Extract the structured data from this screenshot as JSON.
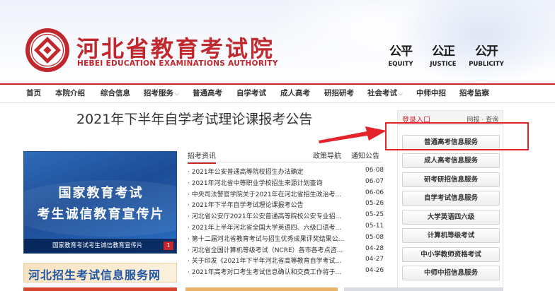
{
  "header": {
    "site_name_cn": "河北省教育考试院",
    "site_name_en": "HEBEI EDUCATION EXAMINATIONS AUTHORITY",
    "slogans": [
      {
        "zh": "公平",
        "en": "EQUITY"
      },
      {
        "zh": "公正",
        "en": "JUSTICE"
      },
      {
        "zh": "公开",
        "en": "PUBLICITY"
      }
    ],
    "brand_color": "#c0282d"
  },
  "nav": {
    "items": [
      {
        "label": "首页",
        "chevron": ""
      },
      {
        "label": "本院介绍",
        "chevron": ""
      },
      {
        "label": "综合信息",
        "chevron": ""
      },
      {
        "label": "招考服务",
        "chevron": "⌵"
      },
      {
        "label": "普通高考",
        "chevron": ""
      },
      {
        "label": "自学考试",
        "chevron": ""
      },
      {
        "label": "成人高考",
        "chevron": ""
      },
      {
        "label": "研招研考",
        "chevron": ""
      },
      {
        "label": "社会考试",
        "chevron": "⌵"
      },
      {
        "label": "中师中招",
        "chevron": ""
      },
      {
        "label": "招考监察",
        "chevron": ""
      }
    ]
  },
  "main": {
    "title": "2021年下半年自学考试理论课报考公告"
  },
  "banner": {
    "line1": "国家教育考试",
    "line2": "考生诚信教育宣传片",
    "caption": "国家教育考试考生诚信教育宣传片",
    "index": "1",
    "secondary": "河北招生考试信息服务网"
  },
  "news": {
    "tabs": [
      "招考资讯",
      "政策导航",
      "通知公告"
    ],
    "items": [
      {
        "title": "· 2021年公安普通高等院校招生办法确定",
        "date": "06-08"
      },
      {
        "title": "· 2021年河北省中等职业学校招生来源计划查询",
        "date": "06-07"
      },
      {
        "title": "· 中央司法警官学院关于2021年在河北省招生政治考...",
        "date": "06-06"
      },
      {
        "title": "· 2021年下半年自学考试理论课报考公告",
        "date": "05-26"
      },
      {
        "title": "· 河北省公安厅2021年公安普通高等院校公安专业招...",
        "date": "05-25"
      },
      {
        "title": "· 2021年上半年河北省全国大学英语四、六级口语考...",
        "date": "05-11"
      },
      {
        "title": "· 第十二届河北省教育考试与招生优秀成果评奖结果公...",
        "date": "05-08"
      },
      {
        "title": "· 河北省全国计算机等级考试（NCRE）各市各考点咨...",
        "date": "04-28"
      },
      {
        "title": "· 关于印发《2021年下半年河北省高等教育自学考试...",
        "date": "04-27"
      },
      {
        "title": "· 2021年高考对口考生考试信息确认和交费工作将于...",
        "date": "04-26"
      }
    ]
  },
  "side": {
    "login_label": "登录入口",
    "aux_label": "网报 · 查询",
    "services": [
      "普通高考信息服务",
      "成人高考信息服务",
      "研考研招信息服务",
      "自学考试信息服务",
      "大学英语四六级",
      "计算机等级考试",
      "中小学教师资格考试",
      "中师中招信息服务"
    ]
  },
  "annotation": {
    "color": "#e4232a"
  }
}
